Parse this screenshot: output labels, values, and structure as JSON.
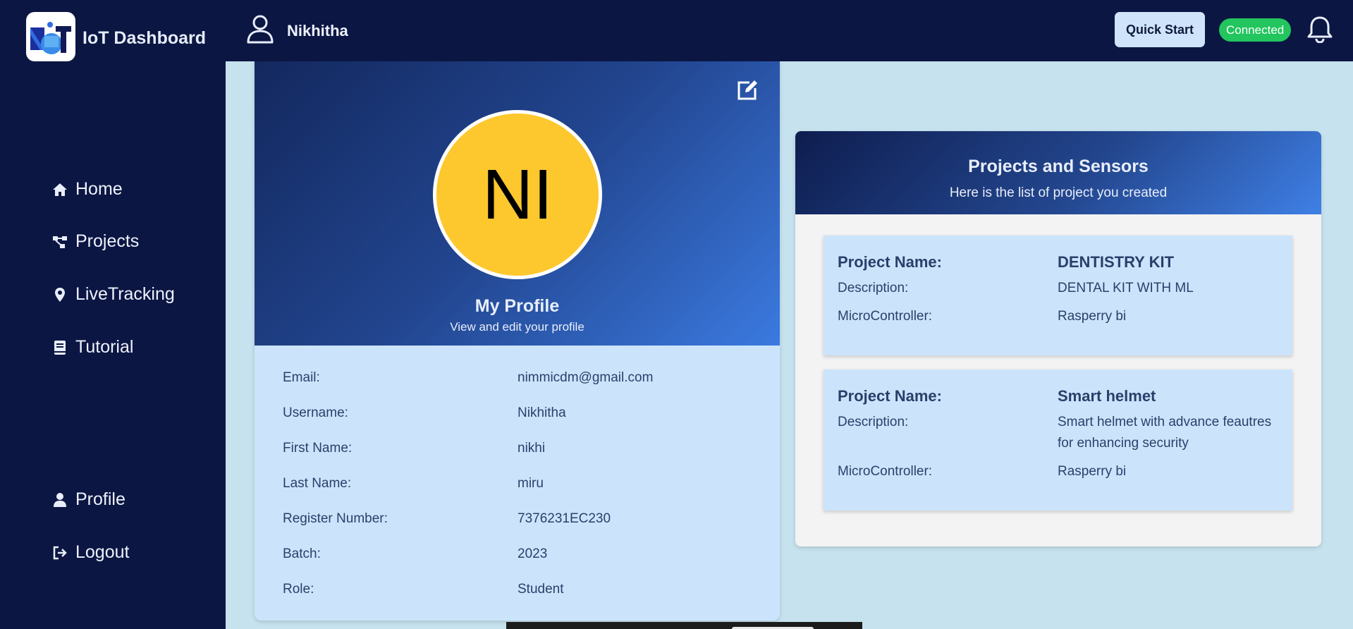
{
  "header": {
    "app_title": "IoT Dashboard",
    "user_name": "Nikhitha",
    "quick_start_label": "Quick Start",
    "status_label": "Connected"
  },
  "sidebar": {
    "items": [
      {
        "label": "Home",
        "icon": "home-icon"
      },
      {
        "label": "Projects",
        "icon": "projects-icon"
      },
      {
        "label": "LiveTracking",
        "icon": "location-pin-icon"
      },
      {
        "label": "Tutorial",
        "icon": "book-icon"
      },
      {
        "label": "Profile",
        "icon": "user-icon"
      },
      {
        "label": "Logout",
        "icon": "logout-icon"
      }
    ]
  },
  "profile": {
    "avatar_initials": "NI",
    "title": "My Profile",
    "subtitle": "View and edit your profile",
    "fields": [
      {
        "label": "Email:",
        "value": "nimmicdm@gmail.com"
      },
      {
        "label": "Username:",
        "value": "Nikhitha"
      },
      {
        "label": "First Name:",
        "value": "nikhi"
      },
      {
        "label": "Last Name:",
        "value": "miru"
      },
      {
        "label": "Register Number:",
        "value": "7376231EC230"
      },
      {
        "label": "Batch:",
        "value": "2023"
      },
      {
        "label": "Role:",
        "value": "Student"
      }
    ]
  },
  "projects": {
    "title": "Projects and Sensors",
    "subtitle": "Here is the list of project you created",
    "name_label": "Project Name:",
    "description_label": "Description:",
    "microcontroller_label": "MicroController:",
    "items": [
      {
        "name": "DENTISTRY KIT",
        "description": "DENTAL KIT WITH ML",
        "microcontroller": "Rasperry bi"
      },
      {
        "name": "Smart helmet",
        "description": "Smart helmet with advance feautres for enhancing security",
        "microcontroller": "Rasperry bi"
      }
    ]
  },
  "colors": {
    "nav_bg": "#0b1643",
    "page_bg": "#c6e2ee",
    "avatar_bg": "#fdc72e",
    "card_light": "#cce4fb",
    "connected": "#22c55e"
  }
}
